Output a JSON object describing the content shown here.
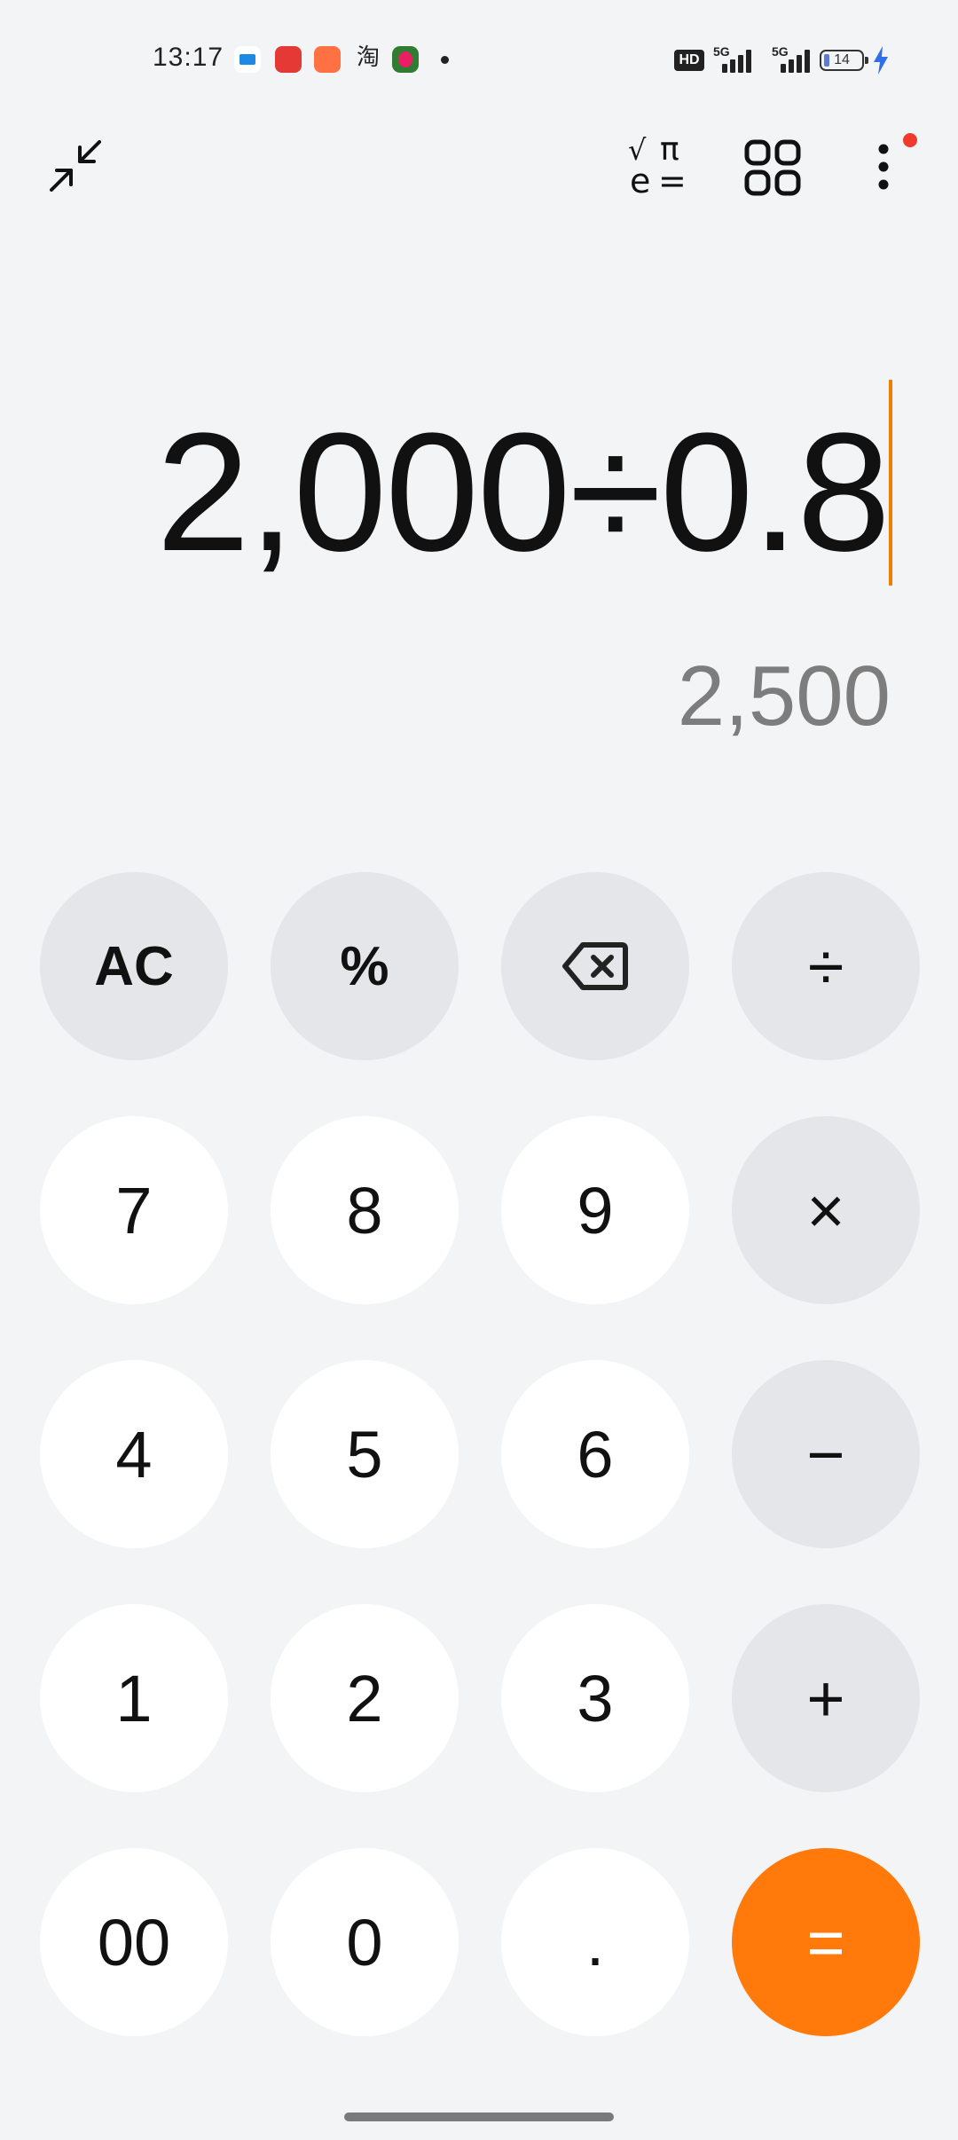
{
  "status_bar": {
    "time": "13:17",
    "hd_label": "HD",
    "signal_1_label": "5G",
    "signal_2_label": "5G",
    "battery_level": "14"
  },
  "toolbar": {
    "collapse_icon": "collapse-arrows-icon",
    "scientific_icon": "scientific-mode-icon",
    "converter_icon": "grid-converter-icon",
    "menu_icon": "more-vertical-icon"
  },
  "display": {
    "expression": "2,000÷0.8",
    "result": "2,500"
  },
  "keypad": {
    "ac": "AC",
    "percent": "%",
    "backspace_icon": "backspace-icon",
    "divide": "÷",
    "seven": "7",
    "eight": "8",
    "nine": "9",
    "multiply": "×",
    "four": "4",
    "five": "5",
    "six": "6",
    "minus": "−",
    "one": "1",
    "two": "2",
    "three": "3",
    "plus": "+",
    "double_zero": "00",
    "zero": "0",
    "decimal": ".",
    "equals": "="
  },
  "colors": {
    "accent": "#ff7a0a",
    "cursor": "#f07c00",
    "notification_dot": "#ef3b2d"
  }
}
